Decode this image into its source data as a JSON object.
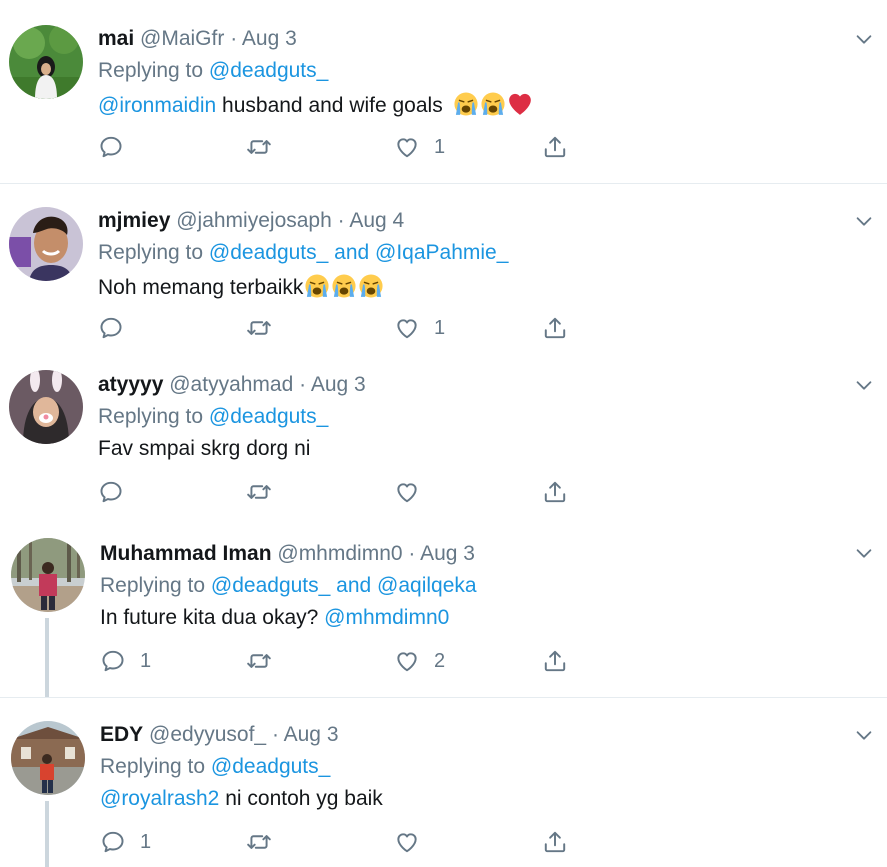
{
  "tweets": [
    {
      "name": "mai",
      "handle": "@MaiGfr",
      "date": "Aug 3",
      "replying_prefix": "Replying to",
      "replying_to": "@deadguts_",
      "mention": "@ironmaidin",
      "text": " husband and wife goals",
      "emojis": [
        "loudly-crying-face",
        "loudly-crying-face",
        "red-heart"
      ],
      "replies": "",
      "likes": "1"
    },
    {
      "name": "mjmiey",
      "handle": "@jahmiyejosaph",
      "date": "Aug 4",
      "replying_prefix": "Replying to",
      "replying_to": "@deadguts_ and @IqaPahmie_",
      "text": "Noh memang terbaikk",
      "emojis": [
        "loudly-crying-face",
        "loudly-crying-face",
        "loudly-crying-face"
      ],
      "replies": "",
      "likes": "1"
    },
    {
      "name": "atyyyy",
      "handle": "@atyyahmad",
      "date": "Aug 3",
      "replying_prefix": "Replying to",
      "replying_to": "@deadguts_",
      "text": "Fav smpai skrg dorg ni",
      "replies": "",
      "likes": ""
    },
    {
      "name": "Muhammad Iman",
      "handle": "@mhmdimn0",
      "date": "Aug 3",
      "replying_prefix": "Replying to",
      "replying_to": "@deadguts_ and @aqilqeka",
      "text": "In future kita dua okay? ",
      "mention_after": "@mhmdimn0",
      "replies": "1",
      "likes": "2"
    },
    {
      "name": "EDY",
      "handle": "@edyyusof_",
      "date": "Aug 3",
      "replying_prefix": "Replying to",
      "replying_to": "@deadguts_",
      "mention": "@royalrash2",
      "text": " ni contoh yg baik",
      "replies": "1",
      "likes": ""
    }
  ],
  "separator": "·",
  "icons": {
    "reply": "reply-bubble-icon",
    "retweet": "retweet-icon",
    "like": "heart-icon",
    "share": "share-icon",
    "more": "chevron-down-icon"
  },
  "colors": {
    "link": "#1b95e0",
    "secondary": "#657786",
    "divider": "#e6ecf0"
  }
}
